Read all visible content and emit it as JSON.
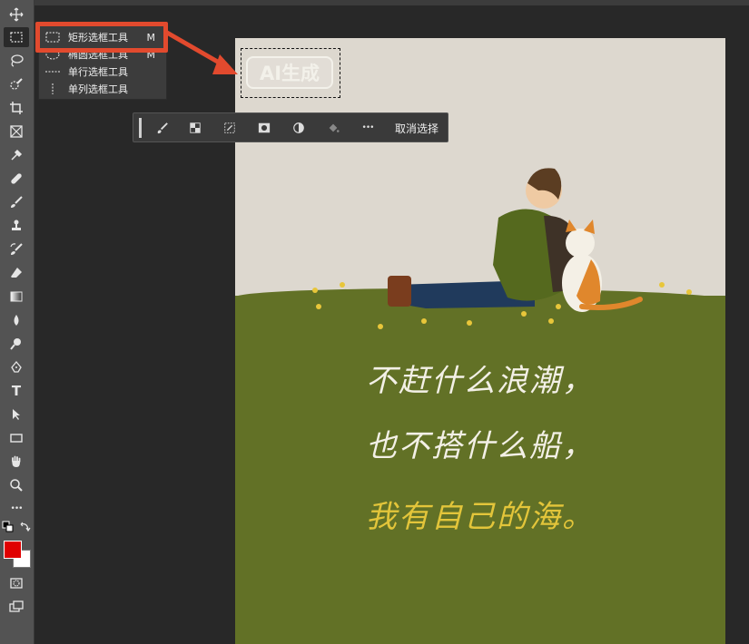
{
  "toolbar": {
    "tools": [
      {
        "name": "move-tool",
        "icon": "move-icon"
      },
      {
        "name": "rectangular-marquee-tool",
        "icon": "marquee-icon"
      },
      {
        "name": "lasso-tool",
        "icon": "lasso-icon"
      },
      {
        "name": "quick-selection-tool",
        "icon": "quick-selection-icon"
      },
      {
        "name": "crop-tool",
        "icon": "crop-icon"
      },
      {
        "name": "frame-tool",
        "icon": "frame-icon"
      },
      {
        "name": "eyedropper-tool",
        "icon": "eyedropper-icon"
      },
      {
        "name": "healing-brush-tool",
        "icon": "bandage-icon"
      },
      {
        "name": "brush-tool",
        "icon": "brush-icon"
      },
      {
        "name": "clone-stamp-tool",
        "icon": "stamp-icon"
      },
      {
        "name": "history-brush-tool",
        "icon": "history-brush-icon"
      },
      {
        "name": "eraser-tool",
        "icon": "eraser-icon"
      },
      {
        "name": "gradient-tool",
        "icon": "gradient-icon"
      },
      {
        "name": "blur-tool",
        "icon": "drop-icon"
      },
      {
        "name": "dodge-tool",
        "icon": "dodge-icon"
      },
      {
        "name": "pen-tool",
        "icon": "pen-icon"
      },
      {
        "name": "type-tool",
        "icon": "type-icon"
      },
      {
        "name": "path-selection-tool",
        "icon": "arrow-icon"
      },
      {
        "name": "rectangle-tool",
        "icon": "rectangle-icon"
      },
      {
        "name": "hand-tool",
        "icon": "hand-icon"
      },
      {
        "name": "zoom-tool",
        "icon": "zoom-icon"
      },
      {
        "name": "more-tools",
        "icon": "ellipsis-icon"
      }
    ],
    "type_glyph": "T",
    "more_glyph": "•••",
    "foreground_color": "#e00000",
    "background_color": "#ffffff"
  },
  "marquee_menu": {
    "items": [
      {
        "label": "矩形选框工具",
        "shortcut": "M"
      },
      {
        "label": "椭圆选框工具",
        "shortcut": "M"
      },
      {
        "label": "单行选框工具",
        "shortcut": ""
      },
      {
        "label": "单列选框工具",
        "shortcut": ""
      }
    ]
  },
  "context_bar": {
    "more_glyph": "•••",
    "deselect_label": "取消选择"
  },
  "canvas": {
    "ai_label": "AI生成",
    "poem": [
      "不赶什么浪潮，",
      "也不搭什么船，",
      "我有自己的海。"
    ]
  },
  "colors": {
    "highlight": "#e24a2e",
    "grass": "#627126",
    "sky": "#ddd8cf"
  }
}
